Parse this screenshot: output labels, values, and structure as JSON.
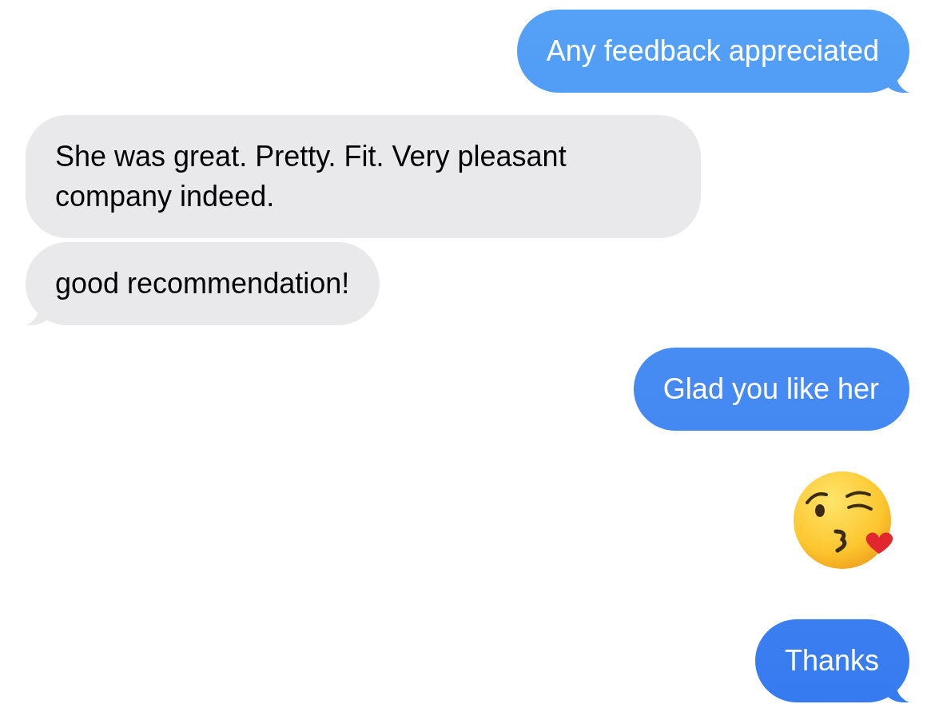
{
  "messages": [
    {
      "kind": "text",
      "outgoing": true,
      "text": "Any feedback appreciated",
      "tail": true
    },
    {
      "kind": "text",
      "outgoing": false,
      "text": "She was great. Pretty. Fit. Very pleasant company indeed.",
      "tail": false
    },
    {
      "kind": "text",
      "outgoing": false,
      "text": "good recommendation!",
      "tail": true
    },
    {
      "kind": "text",
      "outgoing": true,
      "text": "Glad you like her",
      "tail": false
    },
    {
      "kind": "emoji",
      "outgoing": true
    },
    {
      "kind": "text",
      "outgoing": true,
      "text": "Thanks",
      "tail": true
    }
  ]
}
